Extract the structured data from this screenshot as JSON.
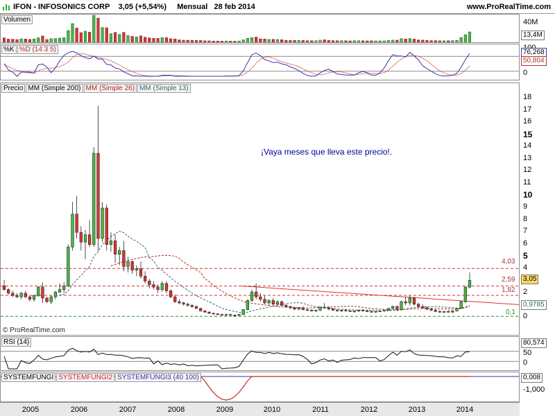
{
  "header": {
    "ticker_text": "IFON - INFOSONICS CORP",
    "price_change": "3,05 (+5,54%)",
    "period": "Mensual",
    "date": "28 feb 2014",
    "site": "www.ProRealTime.com"
  },
  "volume_panel": {
    "title": "Volumen",
    "axis": {
      "top": "40M",
      "mid": "20M"
    },
    "current_value": "13,4M"
  },
  "stoch_panel": {
    "title_k": "%K",
    "title_d": "%D (14 3 5)",
    "axis": {
      "top": "100",
      "bottom": "0"
    },
    "value_k": "76,268",
    "value_d": "50,804"
  },
  "price_panel": {
    "labels": [
      "Precio",
      "MM (Simple 200)",
      "MM (Simple 26)",
      "MM (Simple 13)"
    ],
    "axis_ticks": [
      "18",
      "17",
      "16",
      "15",
      "14",
      "13",
      "12",
      "11",
      "10",
      "9",
      "8",
      "7",
      "6",
      "5",
      "4",
      "3",
      "2",
      "1",
      "0"
    ],
    "bold_ticks": [
      "15",
      "10",
      "5"
    ],
    "current_price": "3,05",
    "ma_value": "0,9785",
    "levels": [
      "4,03",
      "2,59",
      "1,82",
      "0,1"
    ],
    "annotation": "¡Vaya meses que lleva este precio!.",
    "copyright": "© ProRealTime.com"
  },
  "rsi_panel": {
    "title": "RSI (14)",
    "axis": {
      "top": "100",
      "mid": "50",
      "bottom": "0"
    },
    "current_value": "80,574"
  },
  "fungi_panel": {
    "labels": [
      "SYSTEMFUNGI",
      "SYSTEMFUNGI2",
      "SYSTEMFUNGI3 (40 100)"
    ],
    "axis": {
      "zero": "0,000",
      "bottom": "-1,000"
    },
    "current_value": "0,008"
  },
  "xaxis": {
    "years": [
      "2005",
      "2006",
      "2007",
      "2008",
      "2009",
      "2010",
      "2011",
      "2012",
      "2013",
      "2014"
    ]
  },
  "colors": {
    "up": "#44bb44",
    "down": "#dd3333",
    "ma200": "#cc0000",
    "ma26": "#bb2222",
    "ma13": "#336666",
    "trend": "#e03030",
    "accent_blue": "#3333aa",
    "value_box": "#ffd966"
  },
  "chart_data": {
    "type": "candlestick",
    "x": [
      "2005",
      "2006",
      "2007",
      "2008",
      "2009",
      "2010",
      "2011",
      "2012",
      "2013",
      "2014"
    ],
    "candles": [
      {
        "o": 2.6,
        "h": 3.1,
        "l": 2.2,
        "c": 2.3
      },
      {
        "o": 2.3,
        "h": 2.4,
        "l": 1.9,
        "c": 2.0
      },
      {
        "o": 2.0,
        "h": 2.2,
        "l": 1.7,
        "c": 1.8
      },
      {
        "o": 1.8,
        "h": 2.0,
        "l": 1.6,
        "c": 1.7
      },
      {
        "o": 1.7,
        "h": 2.1,
        "l": 1.5,
        "c": 2.0
      },
      {
        "o": 2.0,
        "h": 2.2,
        "l": 1.6,
        "c": 1.7
      },
      {
        "o": 1.7,
        "h": 1.8,
        "l": 1.3,
        "c": 1.5
      },
      {
        "o": 1.5,
        "h": 1.9,
        "l": 1.3,
        "c": 1.8
      },
      {
        "o": 1.8,
        "h": 2.6,
        "l": 1.7,
        "c": 2.5
      },
      {
        "o": 2.5,
        "h": 2.9,
        "l": 1.2,
        "c": 1.6
      },
      {
        "o": 1.6,
        "h": 1.7,
        "l": 1.2,
        "c": 1.3
      },
      {
        "o": 1.3,
        "h": 1.8,
        "l": 1.1,
        "c": 1.7
      },
      {
        "o": 1.7,
        "h": 2.2,
        "l": 1.5,
        "c": 2.1
      },
      {
        "o": 2.1,
        "h": 2.8,
        "l": 2.0,
        "c": 2.3
      },
      {
        "o": 2.3,
        "h": 2.9,
        "l": 2.0,
        "c": 2.6
      },
      {
        "o": 2.6,
        "h": 6.0,
        "l": 2.5,
        "c": 5.8
      },
      {
        "o": 5.8,
        "h": 9.5,
        "l": 5.5,
        "c": 8.5
      },
      {
        "o": 8.5,
        "h": 10.0,
        "l": 6.5,
        "c": 7.0
      },
      {
        "o": 7.0,
        "h": 7.5,
        "l": 5.5,
        "c": 6.2
      },
      {
        "o": 6.2,
        "h": 7.2,
        "l": 4.8,
        "c": 6.8
      },
      {
        "o": 6.8,
        "h": 8.0,
        "l": 5.8,
        "c": 6.0
      },
      {
        "o": 6.0,
        "h": 14.0,
        "l": 5.8,
        "c": 13.5
      },
      {
        "o": 13.5,
        "h": 17.4,
        "l": 5.5,
        "c": 6.5
      },
      {
        "o": 6.5,
        "h": 9.5,
        "l": 6.2,
        "c": 9.0
      },
      {
        "o": 9.0,
        "h": 9.3,
        "l": 5.5,
        "c": 6.0
      },
      {
        "o": 6.0,
        "h": 7.0,
        "l": 5.4,
        "c": 6.3
      },
      {
        "o": 6.3,
        "h": 6.8,
        "l": 4.5,
        "c": 5.2
      },
      {
        "o": 5.2,
        "h": 5.8,
        "l": 4.3,
        "c": 5.5
      },
      {
        "o": 5.5,
        "h": 6.3,
        "l": 3.8,
        "c": 4.2
      },
      {
        "o": 4.2,
        "h": 5.0,
        "l": 3.7,
        "c": 4.6
      },
      {
        "o": 4.6,
        "h": 4.7,
        "l": 3.6,
        "c": 3.9
      },
      {
        "o": 3.9,
        "h": 4.3,
        "l": 3.4,
        "c": 4.0
      },
      {
        "o": 4.0,
        "h": 4.6,
        "l": 3.2,
        "c": 3.4
      },
      {
        "o": 3.4,
        "h": 3.8,
        "l": 2.8,
        "c": 3.0
      },
      {
        "o": 3.0,
        "h": 3.2,
        "l": 2.4,
        "c": 2.7
      },
      {
        "o": 2.7,
        "h": 3.0,
        "l": 2.3,
        "c": 2.5
      },
      {
        "o": 2.5,
        "h": 2.7,
        "l": 2.0,
        "c": 2.3
      },
      {
        "o": 2.3,
        "h": 3.0,
        "l": 2.1,
        "c": 2.8
      },
      {
        "o": 2.8,
        "h": 3.0,
        "l": 2.0,
        "c": 2.2
      },
      {
        "o": 2.2,
        "h": 2.3,
        "l": 1.6,
        "c": 1.7
      },
      {
        "o": 1.7,
        "h": 1.9,
        "l": 1.2,
        "c": 1.3
      },
      {
        "o": 1.3,
        "h": 1.5,
        "l": 1.1,
        "c": 1.2
      },
      {
        "o": 1.2,
        "h": 1.3,
        "l": 1.0,
        "c": 1.1
      },
      {
        "o": 1.1,
        "h": 1.2,
        "l": 0.9,
        "c": 1.0
      },
      {
        "o": 1.0,
        "h": 1.1,
        "l": 0.8,
        "c": 0.9
      },
      {
        "o": 0.9,
        "h": 1.0,
        "l": 0.7,
        "c": 0.75
      },
      {
        "o": 0.75,
        "h": 0.8,
        "l": 0.5,
        "c": 0.55
      },
      {
        "o": 0.55,
        "h": 0.6,
        "l": 0.4,
        "c": 0.45
      },
      {
        "o": 0.45,
        "h": 0.5,
        "l": 0.3,
        "c": 0.35
      },
      {
        "o": 0.35,
        "h": 0.4,
        "l": 0.25,
        "c": 0.3
      },
      {
        "o": 0.3,
        "h": 0.35,
        "l": 0.2,
        "c": 0.25
      },
      {
        "o": 0.25,
        "h": 0.3,
        "l": 0.15,
        "c": 0.2
      },
      {
        "o": 0.2,
        "h": 0.3,
        "l": 0.12,
        "c": 0.25
      },
      {
        "o": 0.25,
        "h": 0.3,
        "l": 0.15,
        "c": 0.2
      },
      {
        "o": 0.2,
        "h": 0.25,
        "l": 0.12,
        "c": 0.18
      },
      {
        "o": 0.18,
        "h": 0.3,
        "l": 0.12,
        "c": 0.25
      },
      {
        "o": 0.25,
        "h": 0.7,
        "l": 0.2,
        "c": 0.65
      },
      {
        "o": 0.65,
        "h": 1.5,
        "l": 0.6,
        "c": 1.4
      },
      {
        "o": 1.4,
        "h": 2.3,
        "l": 1.3,
        "c": 2.1
      },
      {
        "o": 2.1,
        "h": 2.8,
        "l": 1.5,
        "c": 1.7
      },
      {
        "o": 1.7,
        "h": 2.0,
        "l": 1.3,
        "c": 1.5
      },
      {
        "o": 1.5,
        "h": 1.8,
        "l": 1.1,
        "c": 1.2
      },
      {
        "o": 1.2,
        "h": 1.5,
        "l": 1.0,
        "c": 1.4
      },
      {
        "o": 1.4,
        "h": 1.6,
        "l": 1.0,
        "c": 1.1
      },
      {
        "o": 1.1,
        "h": 1.4,
        "l": 0.9,
        "c": 1.3
      },
      {
        "o": 1.3,
        "h": 1.4,
        "l": 0.9,
        "c": 1.0
      },
      {
        "o": 1.0,
        "h": 1.1,
        "l": 0.8,
        "c": 0.9
      },
      {
        "o": 0.9,
        "h": 1.0,
        "l": 0.7,
        "c": 0.8
      },
      {
        "o": 0.8,
        "h": 0.9,
        "l": 0.6,
        "c": 0.7
      },
      {
        "o": 0.7,
        "h": 0.85,
        "l": 0.6,
        "c": 0.8
      },
      {
        "o": 0.8,
        "h": 0.9,
        "l": 0.6,
        "c": 0.65
      },
      {
        "o": 0.65,
        "h": 0.75,
        "l": 0.55,
        "c": 0.6
      },
      {
        "o": 0.6,
        "h": 0.7,
        "l": 0.5,
        "c": 0.55
      },
      {
        "o": 0.55,
        "h": 0.65,
        "l": 0.45,
        "c": 0.6
      },
      {
        "o": 0.6,
        "h": 0.9,
        "l": 0.55,
        "c": 0.85
      },
      {
        "o": 0.85,
        "h": 1.2,
        "l": 0.7,
        "c": 0.8
      },
      {
        "o": 0.8,
        "h": 0.9,
        "l": 0.6,
        "c": 0.7
      },
      {
        "o": 0.7,
        "h": 0.8,
        "l": 0.55,
        "c": 0.6
      },
      {
        "o": 0.6,
        "h": 0.7,
        "l": 0.5,
        "c": 0.55
      },
      {
        "o": 0.55,
        "h": 0.65,
        "l": 0.45,
        "c": 0.6
      },
      {
        "o": 0.6,
        "h": 0.7,
        "l": 0.5,
        "c": 0.55
      },
      {
        "o": 0.55,
        "h": 0.6,
        "l": 0.45,
        "c": 0.5
      },
      {
        "o": 0.5,
        "h": 0.6,
        "l": 0.4,
        "c": 0.55
      },
      {
        "o": 0.55,
        "h": 0.65,
        "l": 0.45,
        "c": 0.6
      },
      {
        "o": 0.6,
        "h": 0.7,
        "l": 0.5,
        "c": 0.55
      },
      {
        "o": 0.55,
        "h": 0.6,
        "l": 0.45,
        "c": 0.5
      },
      {
        "o": 0.5,
        "h": 0.6,
        "l": 0.4,
        "c": 0.45
      },
      {
        "o": 0.45,
        "h": 0.55,
        "l": 0.4,
        "c": 0.5
      },
      {
        "o": 0.5,
        "h": 0.6,
        "l": 0.45,
        "c": 0.55
      },
      {
        "o": 0.55,
        "h": 0.65,
        "l": 0.5,
        "c": 0.6
      },
      {
        "o": 0.6,
        "h": 0.8,
        "l": 0.55,
        "c": 0.75
      },
      {
        "o": 0.75,
        "h": 1.0,
        "l": 0.65,
        "c": 0.9
      },
      {
        "o": 0.9,
        "h": 1.0,
        "l": 0.6,
        "c": 0.65
      },
      {
        "o": 0.65,
        "h": 1.4,
        "l": 0.6,
        "c": 1.3
      },
      {
        "o": 1.3,
        "h": 1.7,
        "l": 1.0,
        "c": 1.2
      },
      {
        "o": 1.2,
        "h": 1.8,
        "l": 1.0,
        "c": 1.6
      },
      {
        "o": 1.6,
        "h": 1.7,
        "l": 1.0,
        "c": 1.1
      },
      {
        "o": 1.1,
        "h": 1.2,
        "l": 0.8,
        "c": 0.9
      },
      {
        "o": 0.9,
        "h": 1.1,
        "l": 0.7,
        "c": 0.8
      },
      {
        "o": 0.8,
        "h": 0.9,
        "l": 0.6,
        "c": 0.7
      },
      {
        "o": 0.7,
        "h": 0.8,
        "l": 0.55,
        "c": 0.6
      },
      {
        "o": 0.6,
        "h": 0.7,
        "l": 0.45,
        "c": 0.5
      },
      {
        "o": 0.5,
        "h": 0.6,
        "l": 0.4,
        "c": 0.45
      },
      {
        "o": 0.45,
        "h": 0.55,
        "l": 0.35,
        "c": 0.5
      },
      {
        "o": 0.5,
        "h": 0.6,
        "l": 0.4,
        "c": 0.45
      },
      {
        "o": 0.45,
        "h": 0.6,
        "l": 0.35,
        "c": 0.55
      },
      {
        "o": 0.55,
        "h": 0.8,
        "l": 0.5,
        "c": 0.75
      },
      {
        "o": 0.75,
        "h": 1.4,
        "l": 0.7,
        "c": 1.3
      },
      {
        "o": 1.3,
        "h": 2.6,
        "l": 1.2,
        "c": 2.5
      },
      {
        "o": 2.5,
        "h": 3.7,
        "l": 2.4,
        "c": 3.05
      }
    ],
    "ylim": [
      0,
      18.5
    ]
  }
}
